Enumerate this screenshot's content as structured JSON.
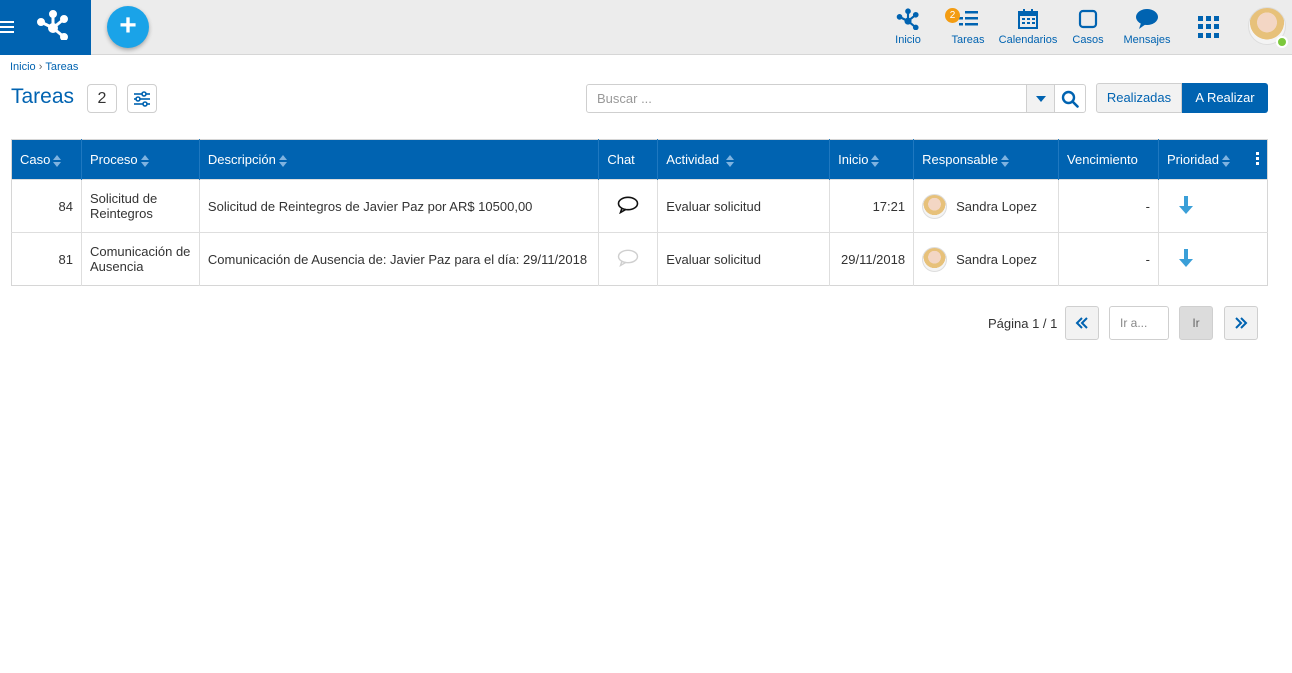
{
  "colors": {
    "brand": "#0063b1",
    "accent": "#1aa3e8",
    "badge": "#f39c12",
    "online": "#7cc83c",
    "priority": "#3a9fd8"
  },
  "topbar": {
    "menu_icon": "hamburger-icon",
    "logo_icon": "network-logo-icon",
    "add_icon": "plus-icon",
    "nav": [
      {
        "label": "Inicio",
        "icon": "network-icon"
      },
      {
        "label": "Tareas",
        "icon": "tasks-icon",
        "badge": "2"
      },
      {
        "label": "Calendarios",
        "icon": "calendar-icon"
      },
      {
        "label": "Casos",
        "icon": "square-icon"
      },
      {
        "label": "Mensajes",
        "icon": "chat-bubble-icon"
      }
    ],
    "apps_icon": "apps-grid-icon"
  },
  "breadcrumb": {
    "home": "Inicio",
    "separator": "›",
    "current": "Tareas"
  },
  "header": {
    "title": "Tareas",
    "count": "2",
    "filter_icon": "sliders-icon"
  },
  "search": {
    "placeholder": "Buscar ...",
    "value": ""
  },
  "toggle": {
    "done": "Realizadas",
    "todo": "A Realizar",
    "selected": "A Realizar"
  },
  "table": {
    "columns": [
      "Caso",
      "Proceso",
      "Descripción",
      "Chat",
      "Actividad",
      "Inicio",
      "Responsable",
      "Vencimiento",
      "Prioridad"
    ],
    "rows": [
      {
        "caso": "84",
        "proceso": "Solicitud de Reintegros",
        "descripcion": "Solicitud de Reintegros de Javier Paz por AR$ 10500,00",
        "chat": "active",
        "actividad": "Evaluar solicitud",
        "inicio": "17:21",
        "responsable": "Sandra Lopez",
        "vencimiento": "-",
        "prioridad": "low"
      },
      {
        "caso": "81",
        "proceso": "Comunicación de Ausencia",
        "descripcion": "Comunicación de Ausencia de: Javier Paz para el día: 29/11/2018",
        "chat": "inactive",
        "actividad": "Evaluar solicitud",
        "inicio": "29/11/2018",
        "responsable": "Sandra Lopez",
        "vencimiento": "-",
        "prioridad": "low"
      }
    ]
  },
  "pagination": {
    "info": "Página 1 / 1",
    "goto_placeholder": "Ir a...",
    "go_label": "Ir"
  }
}
